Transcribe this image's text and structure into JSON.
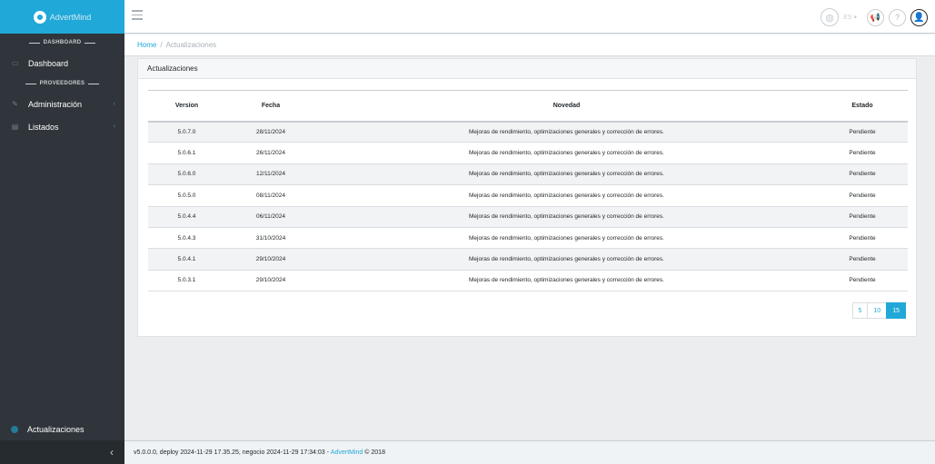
{
  "brand": {
    "name": "AdvertMind"
  },
  "sidebar": {
    "section_dashboard": "DASHBOARD",
    "dashboard": "Dashboard",
    "section_proveedores": "PROVEEDORES",
    "administracion": "Administración",
    "listados": "Listados",
    "actualizaciones": "Actualizaciones"
  },
  "header": {
    "lang": "ES"
  },
  "breadcrumb": {
    "home": "Home",
    "current": "Actualizaciones"
  },
  "card": {
    "title": "Actualizaciones",
    "columns": [
      "Versíon",
      "Fecha",
      "Novedad",
      "Estado"
    ],
    "rows": [
      {
        "version": "5.0.7.0",
        "fecha": "28/11/2024",
        "novedad": "Mejoras de rendimiento, optimizaciones generales y corrección de errores.",
        "estado": "Pendiente"
      },
      {
        "version": "5.0.6.1",
        "fecha": "26/11/2024",
        "novedad": "Mejoras de rendimiento, optimizaciones generales y corrección de errores.",
        "estado": "Pendiente"
      },
      {
        "version": "5.0.6.0",
        "fecha": "12/11/2024",
        "novedad": "Mejoras de rendimiento, optimizaciones generales y corrección de errores.",
        "estado": "Pendiente"
      },
      {
        "version": "5.0.5.0",
        "fecha": "08/11/2024",
        "novedad": "Mejoras de rendimiento, optimizaciones generales y corrección de errores.",
        "estado": "Pendiente"
      },
      {
        "version": "5.0.4.4",
        "fecha": "06/11/2024",
        "novedad": "Mejoras de rendimiento, optimizaciones generales y corrección de errores.",
        "estado": "Pendiente"
      },
      {
        "version": "5.0.4.3",
        "fecha": "31/10/2024",
        "novedad": "Mejoras de rendimiento, optimizaciones generales y corrección de errores.",
        "estado": "Pendiente"
      },
      {
        "version": "5.0.4.1",
        "fecha": "29/10/2024",
        "novedad": "Mejoras de rendimiento, optimizaciones generales y corrección de errores.",
        "estado": "Pendiente"
      },
      {
        "version": "5.0.3.1",
        "fecha": "29/10/2024",
        "novedad": "Mejoras de rendimiento, optimizaciones generales y corrección de errores.",
        "estado": "Pendiente"
      }
    ],
    "page_sizes": [
      "5",
      "10",
      "15"
    ],
    "active_page_size": "15"
  },
  "footer": {
    "text": "v5.0.0.0, deploy 2024-11-29 17.35.25, negocio 2024-11-29 17:34:03 -",
    "brand": "AdvertMind",
    "copyright": "© 2018"
  },
  "colors": {
    "accent": "#20a8d8",
    "sidebar": "#2f353a"
  }
}
